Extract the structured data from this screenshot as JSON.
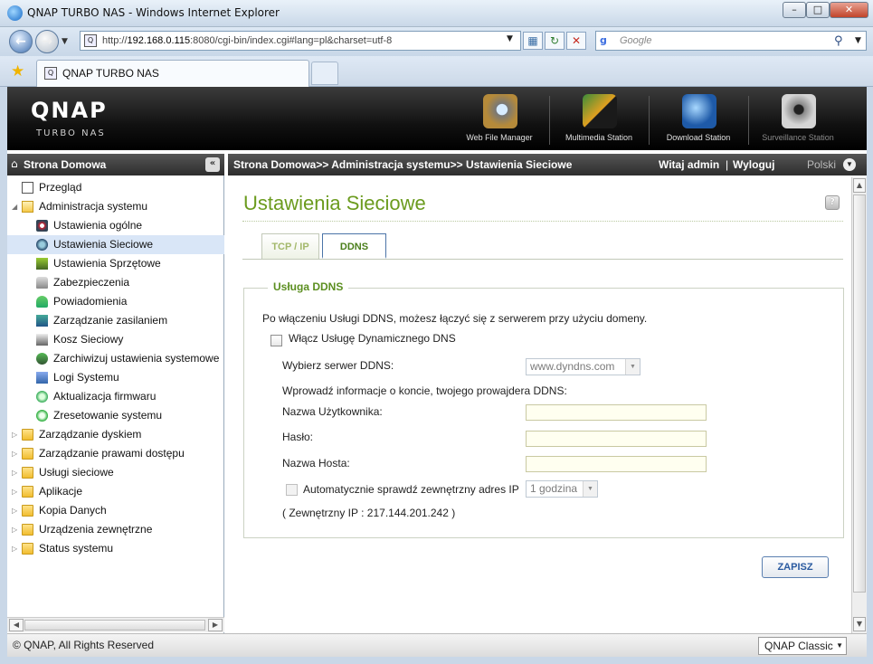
{
  "window": {
    "title": "QNAP TURBO NAS - Windows Internet Explorer",
    "min_label": "–",
    "max_label": "□",
    "close_label": "✕"
  },
  "browser": {
    "url_prefix": "http://",
    "url_host": "192.168.0.115",
    "url_rest": ":8080/cgi-bin/index.cgi#lang=pl&charset=utf-8",
    "search_placeholder": "Google",
    "tab_title": "QNAP TURBO NAS",
    "icons": {
      "back": "back-arrow-icon",
      "forward": "forward-arrow-icon",
      "refresh": "refresh-icon",
      "stop": "stop-icon",
      "search": "magnifier-icon",
      "favorites": "star-icon"
    }
  },
  "banner": {
    "logo": "QNAP",
    "subtitle": "TURBO NAS",
    "apps": [
      {
        "label": "Web File Manager",
        "icon": "web-file-manager-icon"
      },
      {
        "label": "Multimedia Station",
        "icon": "multimedia-station-icon"
      },
      {
        "label": "Download Station",
        "icon": "download-station-icon"
      },
      {
        "label": "Surveillance Station",
        "icon": "surveillance-station-icon"
      }
    ]
  },
  "sidebar": {
    "title": "Strona Domowa",
    "items": [
      {
        "label": "Przegląd"
      },
      {
        "label": "Administracja systemu"
      },
      {
        "label": "Ustawienia ogólne"
      },
      {
        "label": "Ustawienia Sieciowe"
      },
      {
        "label": "Ustawienia Sprzętowe"
      },
      {
        "label": "Zabezpieczenia"
      },
      {
        "label": "Powiadomienia"
      },
      {
        "label": "Zarządzanie zasilaniem"
      },
      {
        "label": "Kosz Sieciowy"
      },
      {
        "label": "Zarchiwizuj ustawienia systemowe"
      },
      {
        "label": "Logi Systemu"
      },
      {
        "label": "Aktualizacja firmwaru"
      },
      {
        "label": "Zresetowanie systemu"
      },
      {
        "label": "Zarządzanie dyskiem"
      },
      {
        "label": "Zarządzanie prawami dostępu"
      },
      {
        "label": "Usługi sieciowe"
      },
      {
        "label": "Aplikacje"
      },
      {
        "label": "Kopia Danych"
      },
      {
        "label": "Urządzenia zewnętrzne"
      },
      {
        "label": "Status systemu"
      }
    ],
    "selected": "Ustawienia Sieciowe"
  },
  "header": {
    "breadcrumb": "Strona Domowa>> Administracja systemu>> Ustawienia Sieciowe",
    "welcome": "Witaj admin",
    "separator": "|",
    "logout": "Wyloguj",
    "language": "Polski"
  },
  "main": {
    "title": "Ustawienia Sieciowe",
    "help": "?",
    "tabs": [
      {
        "label": "TCP / IP",
        "active": false
      },
      {
        "label": "DDNS",
        "active": true
      }
    ],
    "ddns": {
      "legend": "Usługa DDNS",
      "intro": "Po włączeniu Usługi DDNS, możesz łączyć się z serwerem przy użyciu domeny.",
      "enable_label": "Włącz Usługę Dynamicznego DNS",
      "enable_checked": false,
      "server_label": "Wybierz serwer DDNS:",
      "server_value": "www.dyndns.com",
      "account_info": "Wprowadź informacje o koncie, twojego prowajdera DDNS:",
      "username_label": "Nazwa Użytkownika:",
      "username_value": "",
      "password_label": "Hasło:",
      "password_value": "",
      "host_label": "Nazwa Hosta:",
      "host_value": "",
      "auto_check_label": "Automatycznie sprawdź zewnętrzny adres IP",
      "auto_check_checked": false,
      "interval_value": "1 godzina",
      "external_ip": "( Zewnętrzny IP : 217.144.201.242 )"
    },
    "save_label": "ZAPISZ"
  },
  "footer": {
    "copyright": "© QNAP, All Rights Reserved",
    "theme": "QNAP Classic"
  },
  "colors": {
    "accent_green": "#6b9b1e",
    "header_dark": "#2d2d2d",
    "selected_row": "#d9e6f7"
  }
}
